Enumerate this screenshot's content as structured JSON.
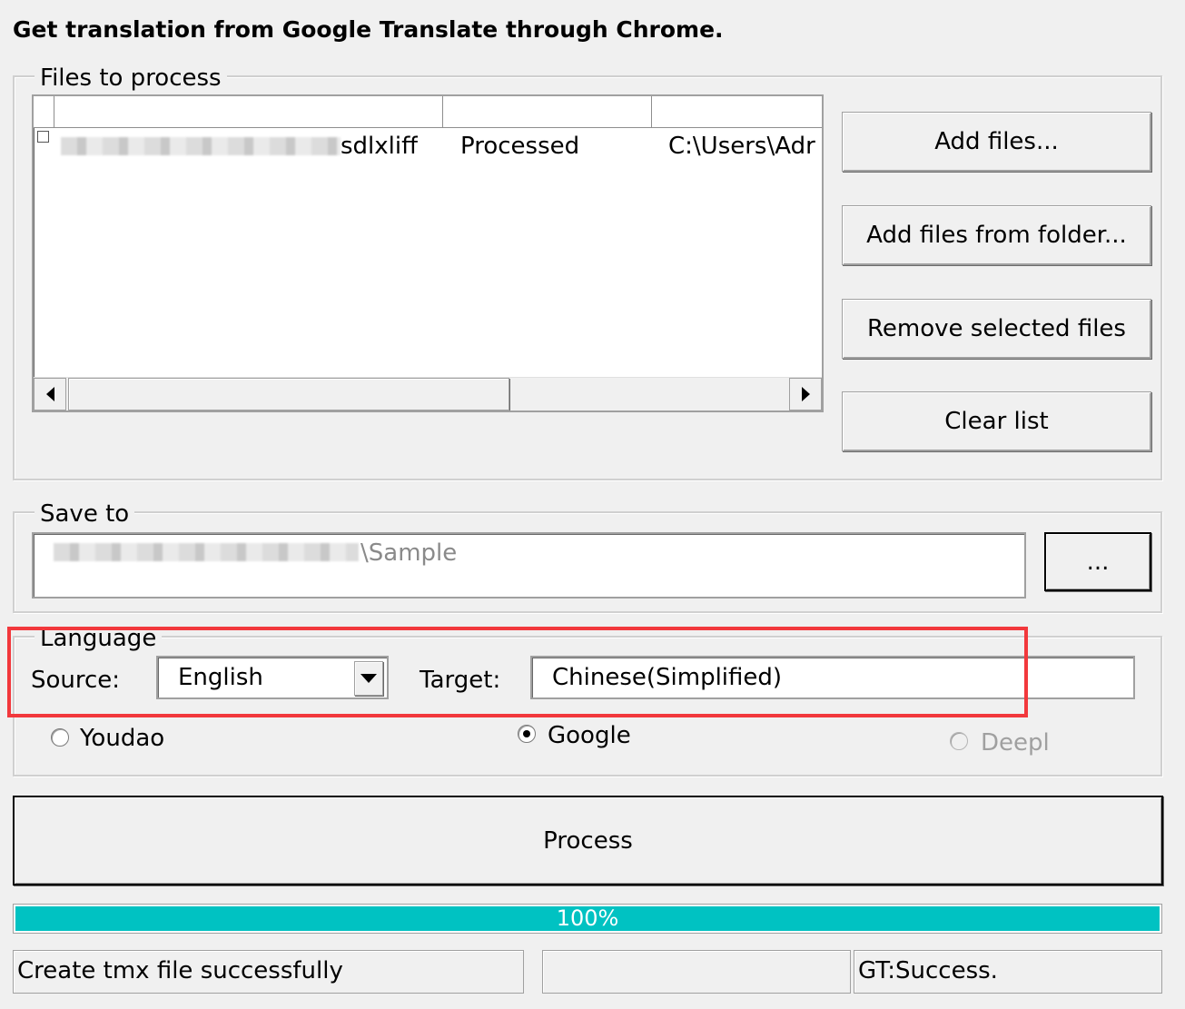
{
  "window": {
    "title": "Get translation from Google Translate through Chrome."
  },
  "files_group": {
    "legend": "Files to process",
    "list": {
      "columns": [
        "",
        "",
        ""
      ],
      "rows": [
        {
          "file_name": "sdlxliff",
          "status": "Processed",
          "path": "C:\\Users\\Adr"
        }
      ]
    },
    "buttons": {
      "add_files": "Add files...",
      "add_from_folder": "Add files from folder...",
      "remove_selected": "Remove selected files",
      "clear_list": "Clear list"
    }
  },
  "save_group": {
    "legend": "Save to",
    "path_value": "\\Sample",
    "browse_label": "..."
  },
  "language_group": {
    "legend": "Language",
    "source_label": "Source:",
    "source_value": "English",
    "target_label": "Target:",
    "target_value": "Chinese(Simplified)",
    "engines": [
      {
        "label": "Youdao",
        "checked": false,
        "enabled": true
      },
      {
        "label": "Google",
        "checked": true,
        "enabled": true
      },
      {
        "label": "Deepl",
        "checked": false,
        "enabled": false
      }
    ]
  },
  "process_button": "Process",
  "progress": {
    "percent": 100,
    "text": "100%",
    "fill_color": "#00c2c2"
  },
  "status_bar": {
    "left": "Create tmx file successfully",
    "middle": "",
    "right": "GT:Success."
  },
  "highlight_color": "#f2383c",
  "icons": {
    "scroll_left": "triangle-left-icon",
    "scroll_right": "triangle-right-icon",
    "dropdown": "triangle-down-icon"
  }
}
